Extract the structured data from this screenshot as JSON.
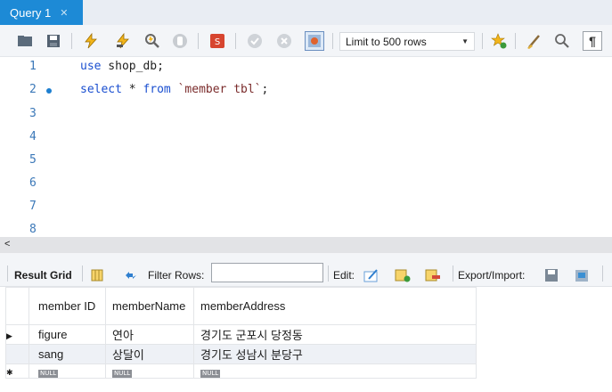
{
  "tab": {
    "title": "Query 1",
    "close": "✕"
  },
  "toolbar": {
    "icons": [
      "folder-icon",
      "save-icon",
      "execute-icon",
      "execute-current-icon",
      "explain-icon",
      "stop-icon",
      "toggle-autocommit-icon",
      "commit-icon",
      "rollback-icon",
      "toggle-limit-icon",
      "bookmark-icon",
      "beautify-icon",
      "find-icon",
      "invisibles-icon"
    ],
    "limit_select": "Limit to 500 rows",
    "colors": {
      "accent": "#1d8ad6"
    }
  },
  "editor": {
    "lines": [
      {
        "num": "1",
        "text": "use shop_db;"
      },
      {
        "num": "2",
        "text": "select * from `member tbl`;"
      },
      {
        "num": "3",
        "text": ""
      },
      {
        "num": "4",
        "text": ""
      },
      {
        "num": "5",
        "text": ""
      },
      {
        "num": "6",
        "text": ""
      },
      {
        "num": "7",
        "text": ""
      },
      {
        "num": "8",
        "text": ""
      }
    ]
  },
  "result_toolbar": {
    "result_grid": "Result Grid",
    "filter_rows": "Filter Rows:",
    "edit": "Edit:",
    "export_import": "Export/Import:"
  },
  "grid": {
    "columns": [
      "member ID",
      "memberName",
      "memberAddress"
    ],
    "rows": [
      [
        "figure",
        "연아",
        "경기도 군포시 당정동"
      ],
      [
        "sang",
        "상달이",
        "경기도 성남시 분당구"
      ]
    ],
    "null_label": "NULL"
  }
}
